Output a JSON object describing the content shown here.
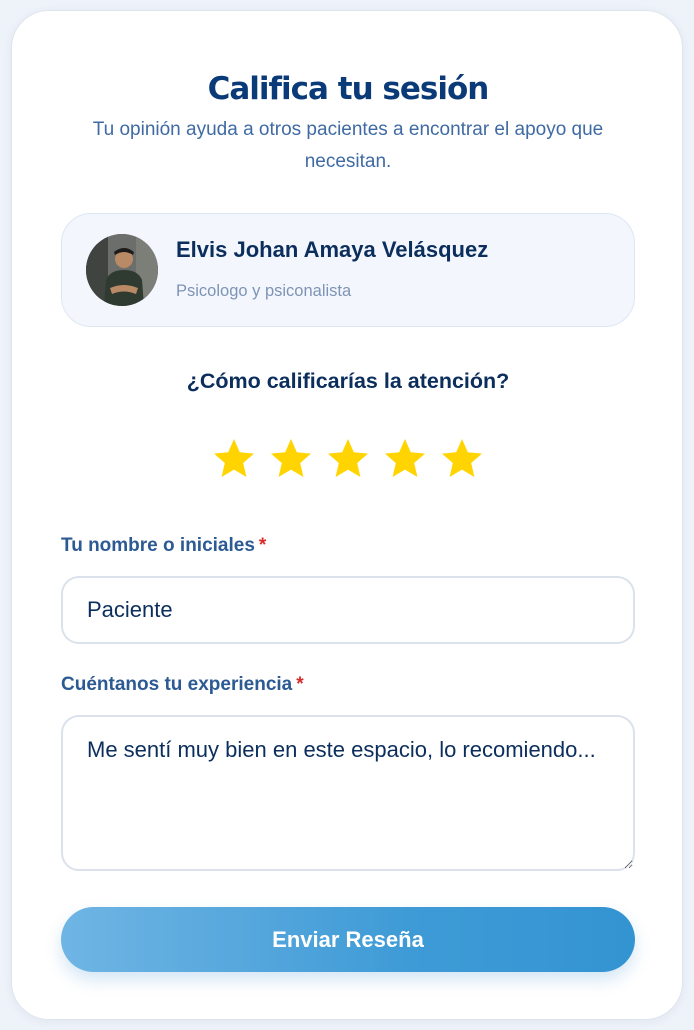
{
  "header": {
    "title": "Califica tu sesión",
    "subtitle": "Tu opinión ayuda a otros pacientes a encontrar el apoyo que necesitan."
  },
  "professional": {
    "name": "Elvis Johan Amaya Velásquez",
    "role": "Psicologo y psiconalista"
  },
  "rating": {
    "question": "¿Cómo calificarías la atención?",
    "value": 5,
    "max": 5,
    "star_color": "#ffd400"
  },
  "form": {
    "name_label": "Tu nombre o iniciales",
    "name_value": "Paciente",
    "experience_label": "Cuéntanos tu experiencia",
    "experience_value": "Me sentí muy bien en este espacio, lo recomiendo...",
    "required_mark": "*",
    "submit_label": "Enviar Reseña"
  },
  "colors": {
    "title": "#0b3a78",
    "accent": "#3f9bd6",
    "required": "#d92b2b"
  }
}
